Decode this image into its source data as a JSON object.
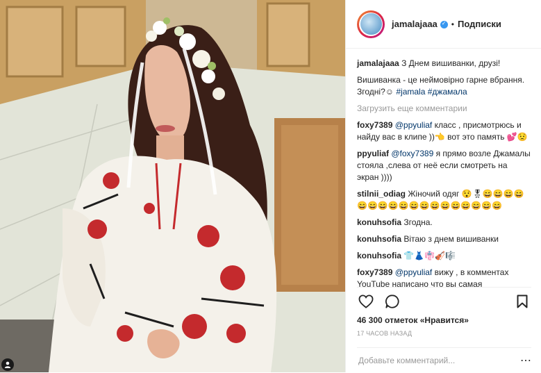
{
  "post": {
    "username": "jamalajaaa",
    "follow_label": "Подписки",
    "dot": "•",
    "caption_user": "jamalajaaa",
    "caption_line1": "З Днем вишиванки, друзі!",
    "caption_line2": "Вишиванка - це неймовірно гарне вбрання. Згодні?",
    "caption_emoji": "☺",
    "caption_tag1": "#jamala",
    "caption_tag2": "#джамала",
    "load_more": "Загрузить еще комментарии",
    "comments": [
      {
        "user": "foxy7389",
        "mention": "@ppyuliaf",
        "text": " класс , присмотрюсь и найду вас в клипе ))👈 вот это память 💕😟"
      },
      {
        "user": "ppyuliaf",
        "mention": "@foxy7389",
        "text": " я прямо возле Джамалы стояла ,слева от неё если смотреть на экран ))))"
      },
      {
        "user": "stilnii_odiag",
        "mention": "",
        "text": " Жіночий одяг 😯🎖😄😄😄😄😄😄😄😄😄😄😄😄😄😄😄😄😄😄"
      },
      {
        "user": "konuhsofia",
        "mention": "",
        "text": " Згодна."
      },
      {
        "user": "konuhsofia",
        "mention": "",
        "text": " Вітаю з днем вишиванки"
      },
      {
        "user": "konuhsofia",
        "mention": "",
        "text": " 👕👗👘🎻🎼"
      },
      {
        "user": "foxy7389",
        "mention": "@ppyuliaf",
        "text": " вижу , в комментах YouTube написано что вы самая"
      }
    ],
    "likes_text": "46 300 отметок «Нравится»",
    "time_text": "17 ЧАСОВ НАЗАД",
    "add_comment_placeholder": "Добавьте комментарий...",
    "more_dots": "⋯"
  },
  "colors": {
    "link": "#003569",
    "muted": "#999999",
    "verified": "#3897f0"
  },
  "icons": [
    "heart-icon",
    "comment-icon",
    "bookmark-icon",
    "user-tag-icon",
    "verified-badge-icon",
    "more-options-icon"
  ]
}
